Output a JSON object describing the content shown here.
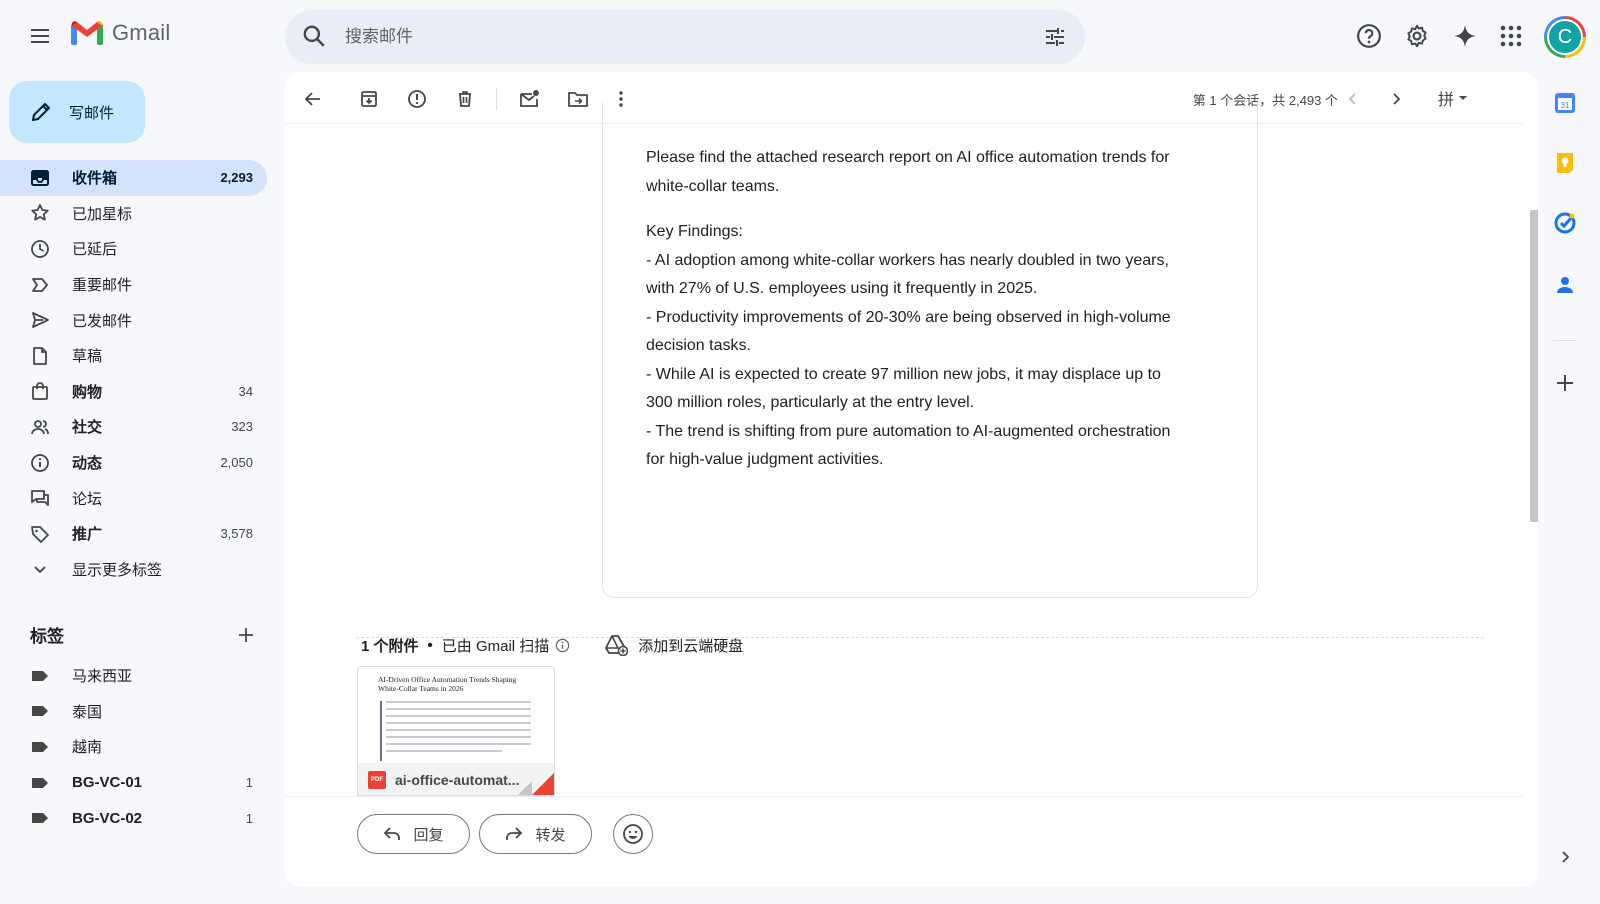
{
  "header": {
    "app_name": "Gmail",
    "search_placeholder": "搜索邮件",
    "avatar_letter": "C"
  },
  "sidebar": {
    "compose_label": "写邮件",
    "items": [
      {
        "label": "收件箱",
        "count": "2,293",
        "icon": "inbox-icon",
        "active": true
      },
      {
        "label": "已加星标",
        "count": "",
        "icon": "star-icon"
      },
      {
        "label": "已延后",
        "count": "",
        "icon": "clock-icon"
      },
      {
        "label": "重要邮件",
        "count": "",
        "icon": "important-icon"
      },
      {
        "label": "已发邮件",
        "count": "",
        "icon": "send-icon"
      },
      {
        "label": "草稿",
        "count": "",
        "icon": "draft-icon"
      },
      {
        "label": "购物",
        "count": "34",
        "icon": "shopping-icon",
        "bold": true
      },
      {
        "label": "社交",
        "count": "323",
        "icon": "social-icon",
        "bold": true
      },
      {
        "label": "动态",
        "count": "2,050",
        "icon": "info-icon",
        "bold": true
      },
      {
        "label": "论坛",
        "count": "",
        "icon": "forum-icon"
      },
      {
        "label": "推广",
        "count": "3,578",
        "icon": "tag-icon",
        "bold": true
      },
      {
        "label": "显示更多标签",
        "count": "",
        "icon": "chevron-down-icon"
      }
    ],
    "labels_title": "标签",
    "labels": [
      {
        "label": "马来西亚",
        "count": ""
      },
      {
        "label": "泰国",
        "count": ""
      },
      {
        "label": "越南",
        "count": ""
      },
      {
        "label": "BG-VC-01",
        "count": "1"
      },
      {
        "label": "BG-VC-02",
        "count": "1"
      }
    ]
  },
  "toolbar": {
    "pager_text": "第 1 个会话，共 2,493 个",
    "ime_label": "拼"
  },
  "message": {
    "intro": [
      "Please find the attached research report on AI office automation trends for",
      "white-collar teams."
    ],
    "findings_title": "Key Findings:",
    "findings": [
      [
        "- AI adoption among white-collar workers has nearly doubled in two years,",
        "with 27% of U.S. employees using it frequently in 2025."
      ],
      [
        "- Productivity improvements of 20-30% are being observed in high-volume",
        "decision tasks."
      ],
      [
        "- While AI is expected to create 97 million new jobs, it may displace up to",
        "300 million roles, particularly at the entry level."
      ],
      [
        "- The trend is shifting from pure automation to AI-augmented orchestration",
        "for high-value judgment activities."
      ]
    ]
  },
  "attachments": {
    "count_label": "1 个附件",
    "scan_label": "已由 Gmail 扫描",
    "add_drive_label": "添加到云端硬盘",
    "file": {
      "doc_title_line1": "AI-Driven Office Automation Trends Shaping",
      "doc_title_line2": "White-Collar Teams in 2026",
      "badge": "PDF",
      "name": "ai-office-automat..."
    }
  },
  "actions": {
    "reply_label": "回复",
    "forward_label": "转发"
  },
  "colors": {
    "accent": "#0b57d0",
    "compose_bg": "#c2e7ff",
    "active_nav_bg": "#d3e3fd",
    "pdf_red": "#ea4335"
  }
}
